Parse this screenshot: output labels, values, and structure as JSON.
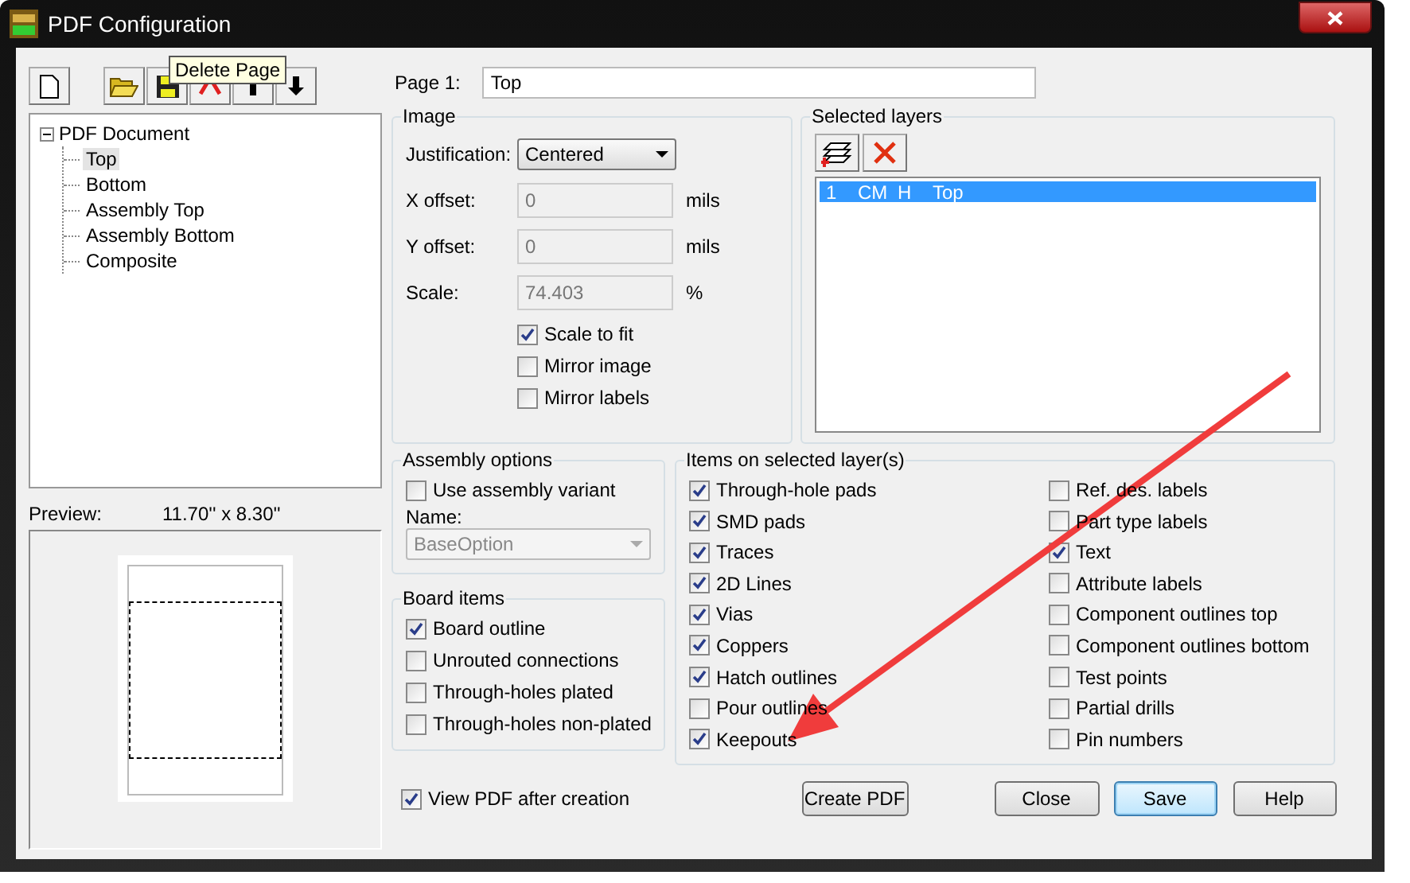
{
  "window": {
    "title": "PDF Configuration"
  },
  "toolbar_tooltip": "Delete Page",
  "tree": {
    "label": "PDF Document",
    "expanded": true,
    "children": [
      {
        "label": "Top",
        "selected": true
      },
      {
        "label": "Bottom",
        "selected": false
      },
      {
        "label": "Assembly Top",
        "selected": false
      },
      {
        "label": "Assembly Bottom",
        "selected": false
      },
      {
        "label": "Composite",
        "selected": false
      }
    ]
  },
  "preview": {
    "label": "Preview:",
    "size": "11.70'' x  8.30''"
  },
  "page": {
    "label": "Page 1:",
    "value": "Top"
  },
  "image": {
    "title": "Image",
    "justification": {
      "label": "Justification:",
      "value": "Centered"
    },
    "fields": [
      {
        "label": "X offset:",
        "value": "0",
        "unit": "mils",
        "disabled": true
      },
      {
        "label": "Y offset:",
        "value": "0",
        "unit": "mils",
        "disabled": true
      },
      {
        "label": "Scale:",
        "value": "74.403",
        "unit": "%",
        "disabled": true
      }
    ],
    "options": [
      {
        "label": "Scale to fit",
        "checked": true
      },
      {
        "label": "Mirror image",
        "checked": false
      },
      {
        "label": "Mirror labels",
        "checked": false
      }
    ]
  },
  "selected_layers": {
    "title": "Selected layers",
    "rows": [
      {
        "cells": [
          "1",
          "CM",
          "H",
          "Top"
        ],
        "selected": true
      }
    ]
  },
  "assembly_options": {
    "title": "Assembly options",
    "use_variant": {
      "label": "Use assembly variant",
      "checked": false
    },
    "name_label": "Name:",
    "name_value": "BaseOption",
    "disabled": true
  },
  "board_items": {
    "title": "Board items",
    "items": [
      {
        "label": "Board outline",
        "checked": true
      },
      {
        "label": "Unrouted connections",
        "checked": false
      },
      {
        "label": "Through-holes plated",
        "checked": false
      },
      {
        "label": "Through-holes non-plated",
        "checked": false
      }
    ]
  },
  "layer_items": {
    "title": "Items on selected layer(s)",
    "items": [
      {
        "label": "Through-hole pads",
        "checked": true
      },
      {
        "label": "SMD pads",
        "checked": true
      },
      {
        "label": "Traces",
        "checked": true
      },
      {
        "label": "2D Lines",
        "checked": true
      },
      {
        "label": "Vias",
        "checked": true
      },
      {
        "label": "Coppers",
        "checked": true
      },
      {
        "label": "Hatch outlines",
        "checked": true
      },
      {
        "label": "Pour outlines",
        "checked": false
      },
      {
        "label": "Keepouts",
        "checked": true
      },
      {
        "label": "Ref. des. labels",
        "checked": false
      },
      {
        "label": "Part type labels",
        "checked": false
      },
      {
        "label": "Text",
        "checked": true
      },
      {
        "label": "Attribute labels",
        "checked": false
      },
      {
        "label": "Component outlines top",
        "checked": false
      },
      {
        "label": "Component outlines bottom",
        "checked": false
      },
      {
        "label": "Test points",
        "checked": false
      },
      {
        "label": "Partial drills",
        "checked": false
      },
      {
        "label": "Pin numbers",
        "checked": false
      }
    ]
  },
  "view_pdf": {
    "label": "View PDF after creation",
    "checked": true
  },
  "buttons": [
    {
      "label": "Create PDF",
      "focused": false
    },
    {
      "label": "Close",
      "focused": false
    },
    {
      "label": "Save",
      "focused": true
    },
    {
      "label": "Help",
      "focused": false
    }
  ]
}
